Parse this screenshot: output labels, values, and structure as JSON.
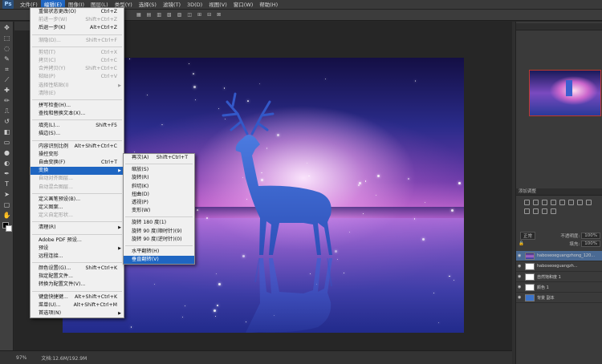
{
  "app": {
    "logo": "Ps"
  },
  "menubar": [
    "文件(F)",
    "编辑(E)",
    "图像(I)",
    "图层(L)",
    "类型(Y)",
    "选择(S)",
    "滤镜(T)",
    "3D(D)",
    "视图(V)",
    "窗口(W)",
    "帮助(H)"
  ],
  "edit_menu": [
    {
      "label": "重做状态更改(O)",
      "shortcut": "Ctrl+Z",
      "disabled": false
    },
    {
      "label": "前进一步(W)",
      "shortcut": "Shift+Ctrl+Z",
      "disabled": true
    },
    {
      "label": "后退一步(K)",
      "shortcut": "Alt+Ctrl+Z",
      "disabled": false
    },
    {
      "sep": true
    },
    {
      "label": "渐隐(D)...",
      "shortcut": "Shift+Ctrl+F",
      "disabled": true
    },
    {
      "sep": true
    },
    {
      "label": "剪切(T)",
      "shortcut": "Ctrl+X",
      "disabled": true
    },
    {
      "label": "拷贝(C)",
      "shortcut": "Ctrl+C",
      "disabled": true
    },
    {
      "label": "合并拷贝(Y)",
      "shortcut": "Shift+Ctrl+C",
      "disabled": true
    },
    {
      "label": "粘贴(P)",
      "shortcut": "Ctrl+V",
      "disabled": true
    },
    {
      "label": "选择性粘贴(I)",
      "shortcut": "",
      "disabled": true,
      "submenu": true
    },
    {
      "label": "清除(E)",
      "shortcut": "",
      "disabled": true
    },
    {
      "sep": true
    },
    {
      "label": "拼写检查(H)...",
      "shortcut": "",
      "disabled": false
    },
    {
      "label": "查找和替换文本(X)...",
      "shortcut": "",
      "disabled": false
    },
    {
      "sep": true
    },
    {
      "label": "填充(L)...",
      "shortcut": "Shift+F5",
      "disabled": false
    },
    {
      "label": "描边(S)...",
      "shortcut": "",
      "disabled": false
    },
    {
      "sep": true
    },
    {
      "label": "内容识别比例",
      "shortcut": "Alt+Shift+Ctrl+C",
      "disabled": false
    },
    {
      "label": "操控变形",
      "shortcut": "",
      "disabled": false
    },
    {
      "label": "自由变换(F)",
      "shortcut": "Ctrl+T",
      "disabled": false
    },
    {
      "label": "变换",
      "shortcut": "",
      "disabled": false,
      "submenu": true,
      "highlighted": true
    },
    {
      "label": "自动对齐图层...",
      "shortcut": "",
      "disabled": true
    },
    {
      "label": "自动混合图层...",
      "shortcut": "",
      "disabled": true
    },
    {
      "sep": true
    },
    {
      "label": "定义画笔预设(B)...",
      "shortcut": "",
      "disabled": false
    },
    {
      "label": "定义图案...",
      "shortcut": "",
      "disabled": false
    },
    {
      "label": "定义自定形状...",
      "shortcut": "",
      "disabled": true
    },
    {
      "sep": true
    },
    {
      "label": "清理(R)",
      "shortcut": "",
      "disabled": false,
      "submenu": true
    },
    {
      "sep": true
    },
    {
      "label": "Adobe PDF 预设...",
      "shortcut": "",
      "disabled": false
    },
    {
      "label": "预设",
      "shortcut": "",
      "disabled": false,
      "submenu": true
    },
    {
      "label": "远程连接...",
      "shortcut": "",
      "disabled": false
    },
    {
      "sep": true
    },
    {
      "label": "颜色设置(G)...",
      "shortcut": "Shift+Ctrl+K",
      "disabled": false
    },
    {
      "label": "指定配置文件...",
      "shortcut": "",
      "disabled": false
    },
    {
      "label": "转换为配置文件(V)...",
      "shortcut": "",
      "disabled": false
    },
    {
      "sep": true
    },
    {
      "label": "键盘快捷键...",
      "shortcut": "Alt+Shift+Ctrl+K",
      "disabled": false
    },
    {
      "label": "菜单(U)...",
      "shortcut": "Alt+Shift+Ctrl+M",
      "disabled": false
    },
    {
      "label": "首选项(N)",
      "shortcut": "",
      "disabled": false,
      "submenu": true
    }
  ],
  "transform_menu": [
    {
      "label": "再次(A)",
      "shortcut": "Shift+Ctrl+T"
    },
    {
      "sep": true
    },
    {
      "label": "缩放(S)",
      "shortcut": ""
    },
    {
      "label": "旋转(R)",
      "shortcut": ""
    },
    {
      "label": "斜切(K)",
      "shortcut": ""
    },
    {
      "label": "扭曲(D)",
      "shortcut": ""
    },
    {
      "label": "透视(P)",
      "shortcut": ""
    },
    {
      "label": "变形(W)",
      "shortcut": ""
    },
    {
      "sep": true
    },
    {
      "label": "旋转 180 度(1)",
      "shortcut": ""
    },
    {
      "label": "旋转 90 度(顺时针)(9)",
      "shortcut": ""
    },
    {
      "label": "旋转 90 度(逆时针)(0)",
      "shortcut": ""
    },
    {
      "sep": true
    },
    {
      "label": "水平翻转(H)",
      "shortcut": ""
    },
    {
      "label": "垂直翻转(V)",
      "shortcut": "",
      "highlighted": true
    }
  ],
  "status": {
    "zoom": "97%",
    "doc": "文档:12.6M/192.9M"
  },
  "layers": {
    "blend": "正常",
    "opacity_label": "不透明度:",
    "opacity": "100%",
    "fill_label": "填充:",
    "fill": "100%",
    "rows": [
      {
        "name": "haboseoeguangzhong_120...",
        "thumb": "img",
        "selected": true
      },
      {
        "name": "haboseoeguangzh...",
        "thumb": "white",
        "selected": false
      },
      {
        "name": "自然饱和度 1",
        "thumb": "white",
        "selected": false
      },
      {
        "name": "颜色 1",
        "thumb": "white",
        "selected": false
      },
      {
        "name": "背景 副本",
        "thumb": "blue",
        "selected": false
      }
    ]
  },
  "panels": {
    "adjust_title": "添加调整"
  }
}
